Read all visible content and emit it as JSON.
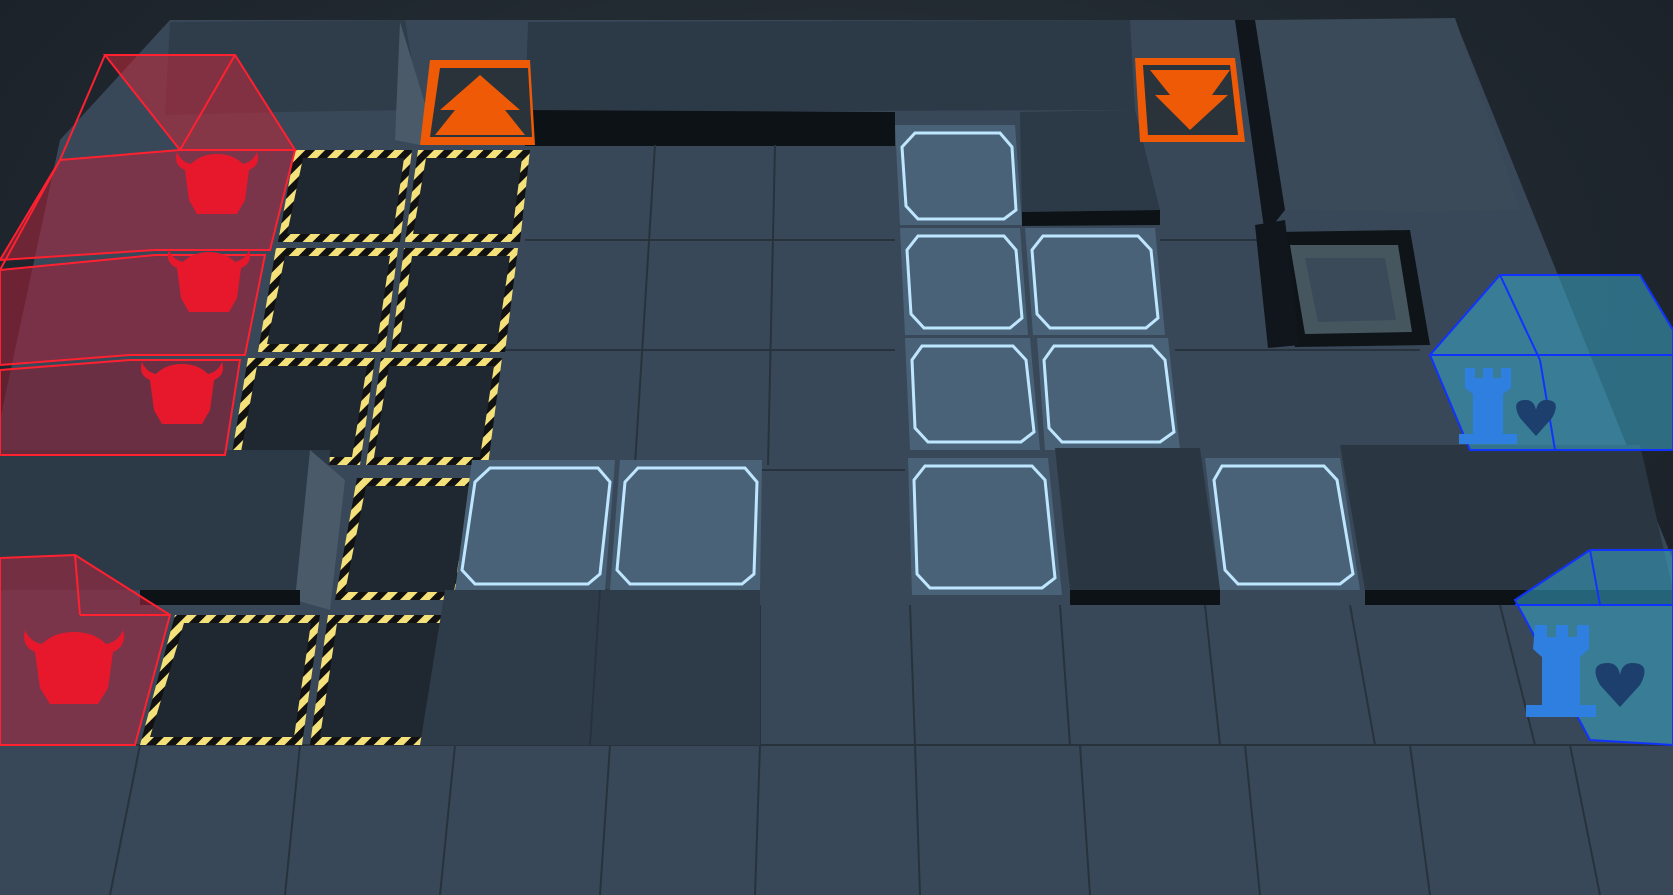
{
  "scene": {
    "name": "tactical-board",
    "colors": {
      "background": "#1f2730",
      "floor": "#3a4a5a",
      "floor_dark": "#2f3d4a",
      "raised_top": "#2c3a47",
      "raised_side": "#11161c",
      "pit": "#1e2730",
      "hazard_yellow": "#f4e17a",
      "hazard_black": "#111111",
      "glow_tile_fill": "#4a6278",
      "glow_tile_edge": "#bfe6ff",
      "arrow_orange": "#ee5a05",
      "red_team": "#e8182c",
      "blue_team": "#2f7fe0"
    },
    "icons": {
      "red_unit_icon": "horned-helmet-icon",
      "blue_unit_icon": "tower-heart-icon",
      "ramp_up_icon": "double-arrow-up-icon",
      "ramp_down_icon": "double-arrow-down-icon",
      "hole_icon": "square-frame-icon"
    },
    "units": {
      "red_count": 4,
      "blue_count": 2
    }
  }
}
